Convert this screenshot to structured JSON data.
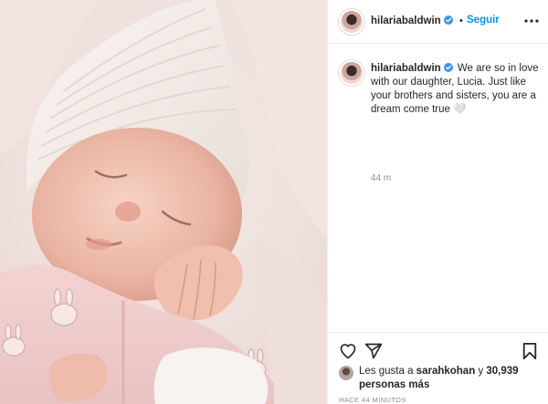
{
  "post": {
    "author": "hilariabaldwin",
    "follow_label": "Seguir",
    "separator": "•",
    "caption": "We are so in love with our daughter, Lucia. Just like your brothers and sisters, you are a dream come true",
    "caption_emoji": "🤍",
    "time_ago": "44 m",
    "likes_prefix": "Les gusta a",
    "likes_user": "sarahkohan",
    "likes_joiner": "y",
    "likes_count": "30,939 personas más",
    "posted_time": "HACE 44 MINUTOS"
  },
  "colors": {
    "accent": "#0095f6",
    "verified": "#3897f0",
    "text": "#262626",
    "muted": "#8e8e8e"
  },
  "icons": {
    "like": "heart-icon",
    "share": "paper-plane-icon",
    "save": "bookmark-icon",
    "verified": "verified-badge-icon",
    "more": "more-options-icon"
  }
}
